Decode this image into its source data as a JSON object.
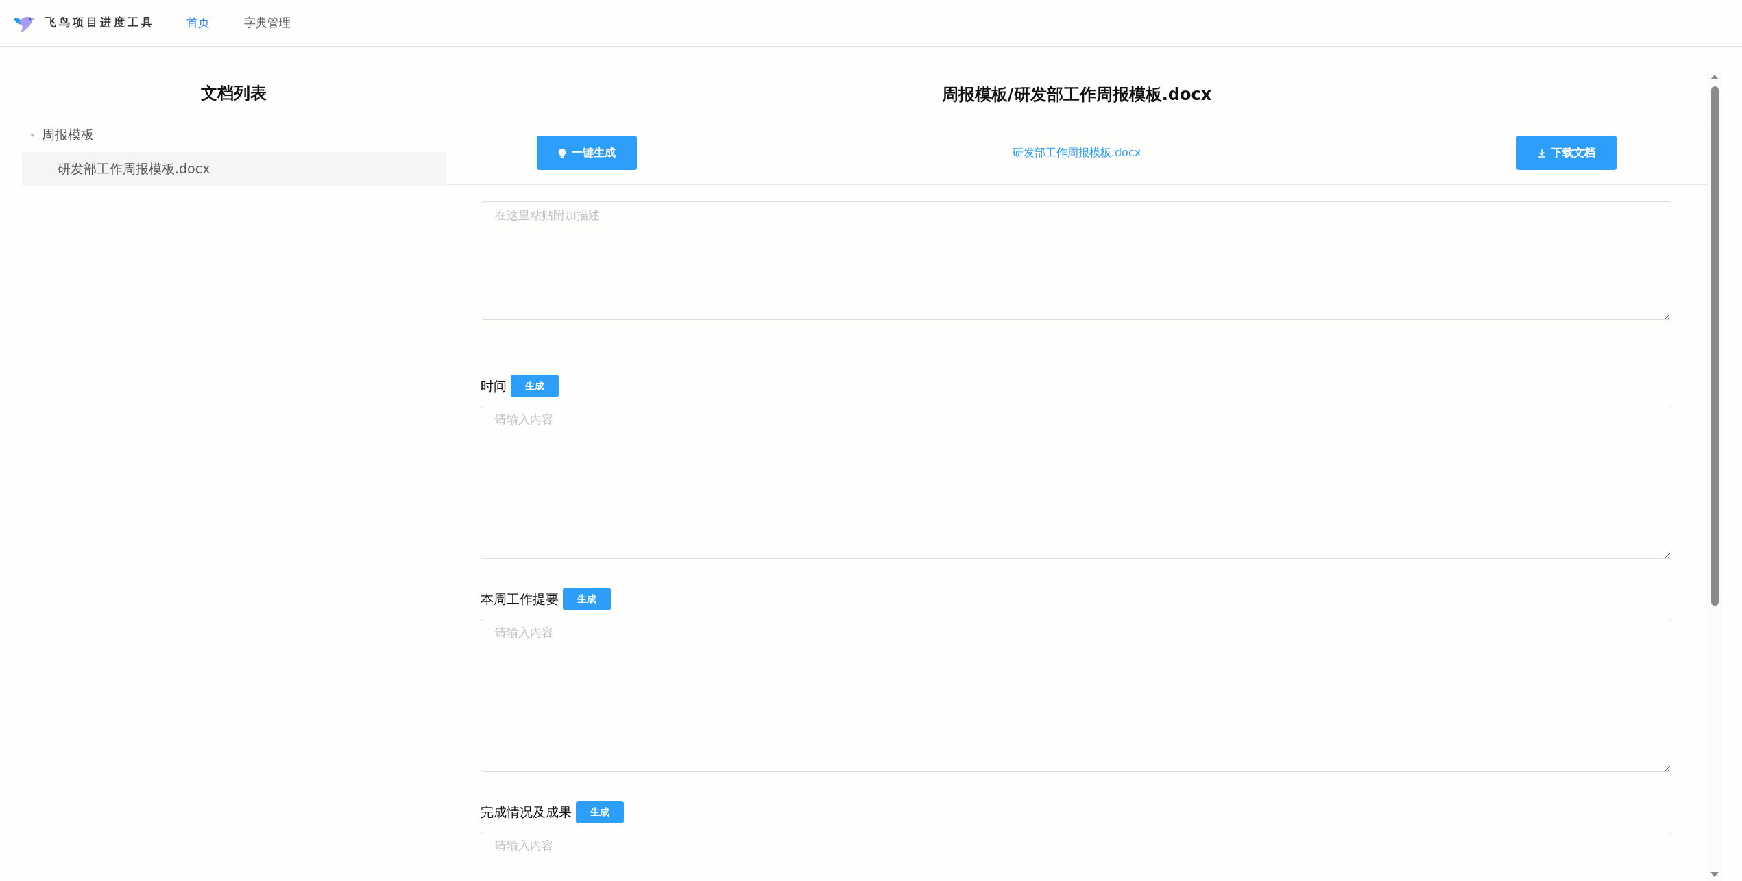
{
  "header": {
    "app_name": "飞鸟项目进度工具",
    "nav": [
      {
        "label": "首页",
        "selected": true
      },
      {
        "label": "字典管理",
        "selected": false
      }
    ]
  },
  "sidebar": {
    "title": "文档列表",
    "tree": [
      {
        "label": "周报模板",
        "expanded": true,
        "children": [
          {
            "label": "研发部工作周报模板.docx",
            "selected": true
          }
        ]
      }
    ]
  },
  "editor": {
    "title": "周报模板/研发部工作周报模板.docx",
    "toolbar": {
      "generate_all": "一键生成",
      "file_link": "研发部工作周报模板.docx",
      "download": "下载文档"
    },
    "fields": [
      {
        "kind": "note",
        "placeholder": "在这里粘贴附加描述"
      },
      {
        "kind": "section",
        "label": "时间",
        "button": "生成",
        "placeholder": "请输入内容"
      },
      {
        "kind": "section",
        "label": "本周工作提要",
        "button": "生成",
        "placeholder": "请输入内容"
      },
      {
        "kind": "section",
        "label": "完成情况及成果",
        "button": "生成",
        "placeholder": "请输入内容"
      }
    ]
  }
}
